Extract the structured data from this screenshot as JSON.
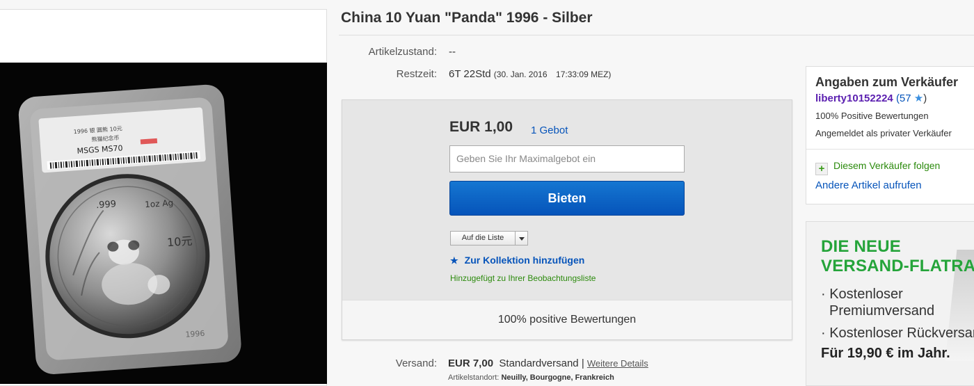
{
  "listing": {
    "title": "China 10 Yuan \"Panda\" 1996 - Silber",
    "condition_label": "Artikelzustand:",
    "condition_value": "--",
    "time_label": "Restzeit:",
    "time_value": "6T 22Std",
    "time_end_date": "(30. Jan. 2016",
    "time_end_time": "17:33:09 MEZ)"
  },
  "slab": {
    "line1": "1996 银 圆熊 10元",
    "line2": "熊猫纪念币",
    "grade": "MSGS MS70",
    "purity": ".999",
    "weight": "1oz Ag",
    "denomination": "10元",
    "year": "1996"
  },
  "bid": {
    "price": "EUR 1,00",
    "bids_link": "1 Gebot",
    "input_placeholder": "Geben Sie Ihr Maximalgebot ein",
    "bid_button": "Bieten",
    "watch_button": "Auf die Liste",
    "collection_link": "Zur Kollektion hinzufügen",
    "watch_status": "Hinzugefügt zu Ihrer Beobachtungsliste",
    "feedback": "100% positive Bewertungen"
  },
  "shipping": {
    "label": "Versand:",
    "price": "EUR 7,00",
    "method": "Standardversand",
    "separator": "|",
    "details_link": "Weitere Details",
    "location_label": "Artikelstandort:",
    "location_value": "Neuilly, Bourgogne, Frankreich"
  },
  "seller": {
    "heading": "Angaben zum Verkäufer",
    "name": "liberty10152224",
    "score_open": "(57",
    "score_close": ")",
    "positive": "100% Positive Bewertungen",
    "registered": "Angemeldet als privater Verkäufer",
    "follow": "Diesem Verkäufer folgen",
    "other_items": "Andere Artikel aufrufen"
  },
  "ad": {
    "headline1": "DIE NEUE",
    "headline2": "VERSAND-FLATRATE",
    "bullet1a": "· Kostenloser",
    "bullet1b": "Premiumversand",
    "bullet2": "· Kostenloser Rückversand",
    "price": "Für 19,90 € im Jahr."
  },
  "colors": {
    "link": "#0654ba",
    "bid_button": "#0654ba",
    "seller_name": "#5b1fb0",
    "success": "#2b8a0c",
    "ad_headline": "#25a43a"
  }
}
